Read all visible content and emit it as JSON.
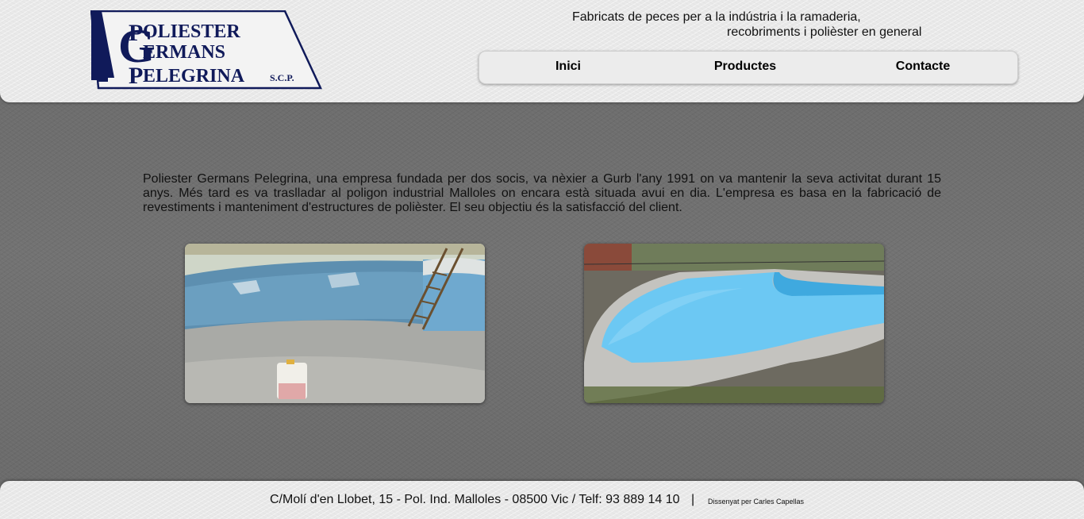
{
  "header": {
    "logo": {
      "line1": "OLIESTER",
      "line2": "ERMANS",
      "line3": "ELEGRINA",
      "suffix": "S.C.P.",
      "big_p": "P",
      "big_g": "G",
      "brand_color": "#101a5a"
    },
    "tagline_line1": "Fabricats de peces per a la indústria i la ramaderia,",
    "tagline_line2": "recobriments i polièster en general"
  },
  "nav": {
    "items": [
      {
        "label": "Inici"
      },
      {
        "label": "Productes"
      },
      {
        "label": "Contacte"
      }
    ]
  },
  "main": {
    "intro": "Poliester Germans Pelegrina, una empresa fundada per dos socis, va nèxier a Gurb l'any 1991 on va mantenir la seva activitat durant 15 anys. Més tard es va traslladar al poligon industrial Malloles on encara està situada avui en dia. L'empresa es basa en la fabricació de revestiments i manteniment d'estructures de polièster. El seu objectiu és la satisfacció del client.",
    "photos": [
      {
        "subject": "empty-pool-before-repair"
      },
      {
        "subject": "repaired-blue-pool-after"
      }
    ]
  },
  "footer": {
    "address": "C/Molí d'en Llobet, 15 - Pol. Ind. Malloles - 08500 Vic / Telf: 93 889 14 10",
    "separator": "|",
    "credit": "Dissenyat per Carles Capellas"
  }
}
